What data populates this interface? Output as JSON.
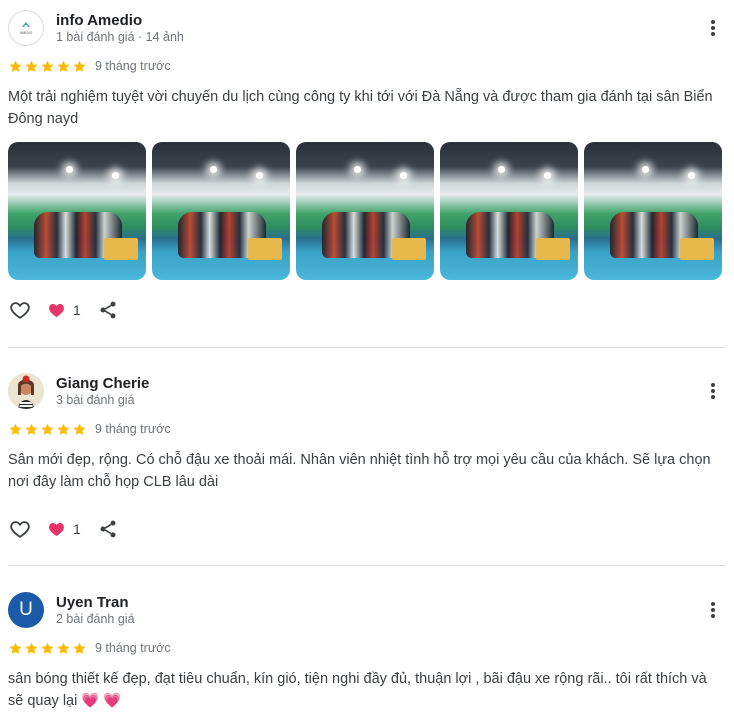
{
  "reviews": [
    {
      "name": "info Amedio",
      "meta": "1 bài đánh giá · 14 ảnh",
      "rating": 5,
      "time": "9 tháng trước",
      "text": "Một trải nghiệm tuyệt vời chuyến du lịch cùng công ty khi tới với Đà Nẵng và được tham gia đánh tại sân Biển Đông nayd",
      "avatar_text": "AMEDIO",
      "photos_count": 5,
      "likes": "1"
    },
    {
      "name": "Giang Cherie",
      "meta": "3 bài đánh giá",
      "rating": 5,
      "time": "9 tháng trước",
      "text": "Sân mới đẹp, rộng. Có chỗ đậu xe thoải mái. Nhân viên nhiệt tình hỗ trợ mọi yêu cầu của khách. Sẽ lựa chọn nơi đây làm chỗ họp CLB lâu dài",
      "likes": "1"
    },
    {
      "name": "Uyen Tran",
      "meta": "2 bài đánh giá",
      "rating": 5,
      "time": "9 tháng trước",
      "text": "sân bóng thiết kế đẹp, đạt tiêu chuẩn, kín gió, tiện nghi đầy đủ, thuận lợi , bãi đậu xe rộng rãi.. tôi rất thích và sẽ quay lại 💗 💗",
      "avatar_initial": "U"
    }
  ],
  "colors": {
    "star": "#fbbc04",
    "heart_badge": "#e8336b",
    "avatar_uyen": "#1a5aa6"
  },
  "icons": [
    "heart-outline-icon",
    "heart-reaction-icon",
    "share-icon",
    "more-vert-icon",
    "star-icon"
  ]
}
